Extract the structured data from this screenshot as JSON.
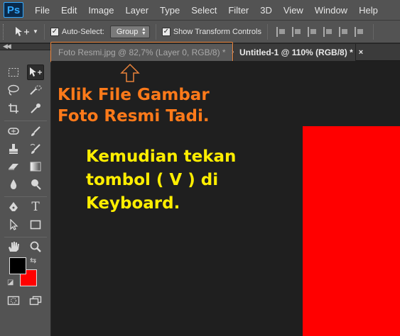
{
  "app": {
    "logo": "Ps"
  },
  "menu": [
    "File",
    "Edit",
    "Image",
    "Layer",
    "Type",
    "Select",
    "Filter",
    "3D",
    "View",
    "Window",
    "Help"
  ],
  "options": {
    "auto_select_label": "Auto-Select:",
    "auto_select_checked": true,
    "auto_select_mode": "Group",
    "show_transform_label": "Show Transform Controls",
    "show_transform_checked": true
  },
  "tabs": [
    {
      "label": "Foto Resmi.jpg @ 82,7% (Layer 0, RGB/8) *",
      "close": "×",
      "active": false
    },
    {
      "label": "Untitled-1 @ 110% (RGB/8) *",
      "close": "×",
      "active": true
    }
  ],
  "annotations": {
    "orange_line1": "Klik File Gambar",
    "orange_line2": "Foto Resmi Tadi.",
    "yellow_line1": "Kemudian tekan",
    "yellow_line2": "tombol ( V ) di",
    "yellow_line3": "Keyboard."
  },
  "colors": {
    "foreground": "#000000",
    "background": "#ff0000",
    "annotation_orange": "#ff7a1a",
    "annotation_yellow": "#ffee00",
    "highlight_border": "#e8823a"
  },
  "tools": [
    "rectangular-marquee-icon",
    "move-icon",
    "lasso-icon",
    "quick-selection-icon",
    "crop-icon",
    "eyedropper-icon",
    "spot-healing-icon",
    "brush-icon",
    "clone-stamp-icon",
    "history-brush-icon",
    "eraser-icon",
    "gradient-icon",
    "blur-icon",
    "dodge-icon",
    "pen-icon",
    "type-icon",
    "path-selection-icon",
    "rectangle-shape-icon",
    "hand-icon",
    "zoom-icon",
    "quick-mask-icon",
    "screen-mode-icon"
  ]
}
